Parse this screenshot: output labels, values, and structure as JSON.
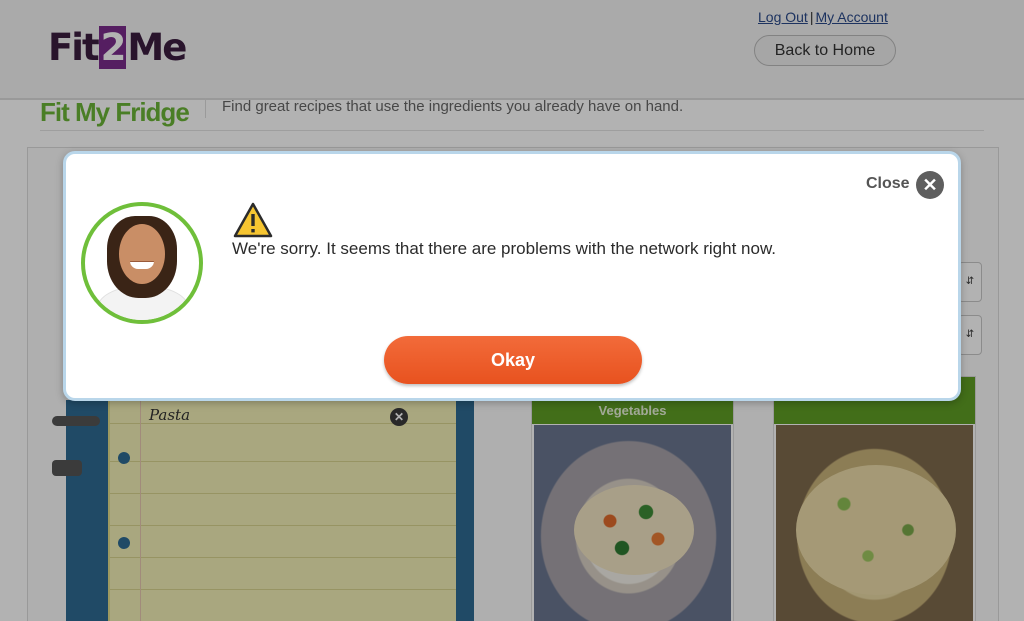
{
  "header": {
    "logo_left": "Fit",
    "logo_mid": "2",
    "logo_right": "Me",
    "logout_link": "Log Out",
    "separator": "|",
    "account_link": "My Account",
    "home_button": "Back to Home"
  },
  "page": {
    "title": "Fit My Fridge",
    "description": "Find great recipes that use the ingredients you already have on hand."
  },
  "notepad": {
    "items": [
      "Pasta"
    ]
  },
  "recipes": [
    {
      "label": "Vegetables"
    },
    {
      "label": ""
    }
  ],
  "modal": {
    "close_label": "Close",
    "message": "We're sorry. It seems that there are problems with the network right now.",
    "okay_button": "Okay"
  },
  "icons": {
    "close": "close-icon",
    "warning": "warning-icon",
    "remove": "remove-icon"
  },
  "colors": {
    "brand_purple": "#7a2c8c",
    "accent_green": "#6bb537",
    "okay_orange": "#ef5f2a",
    "modal_border": "#b9d6ea"
  }
}
